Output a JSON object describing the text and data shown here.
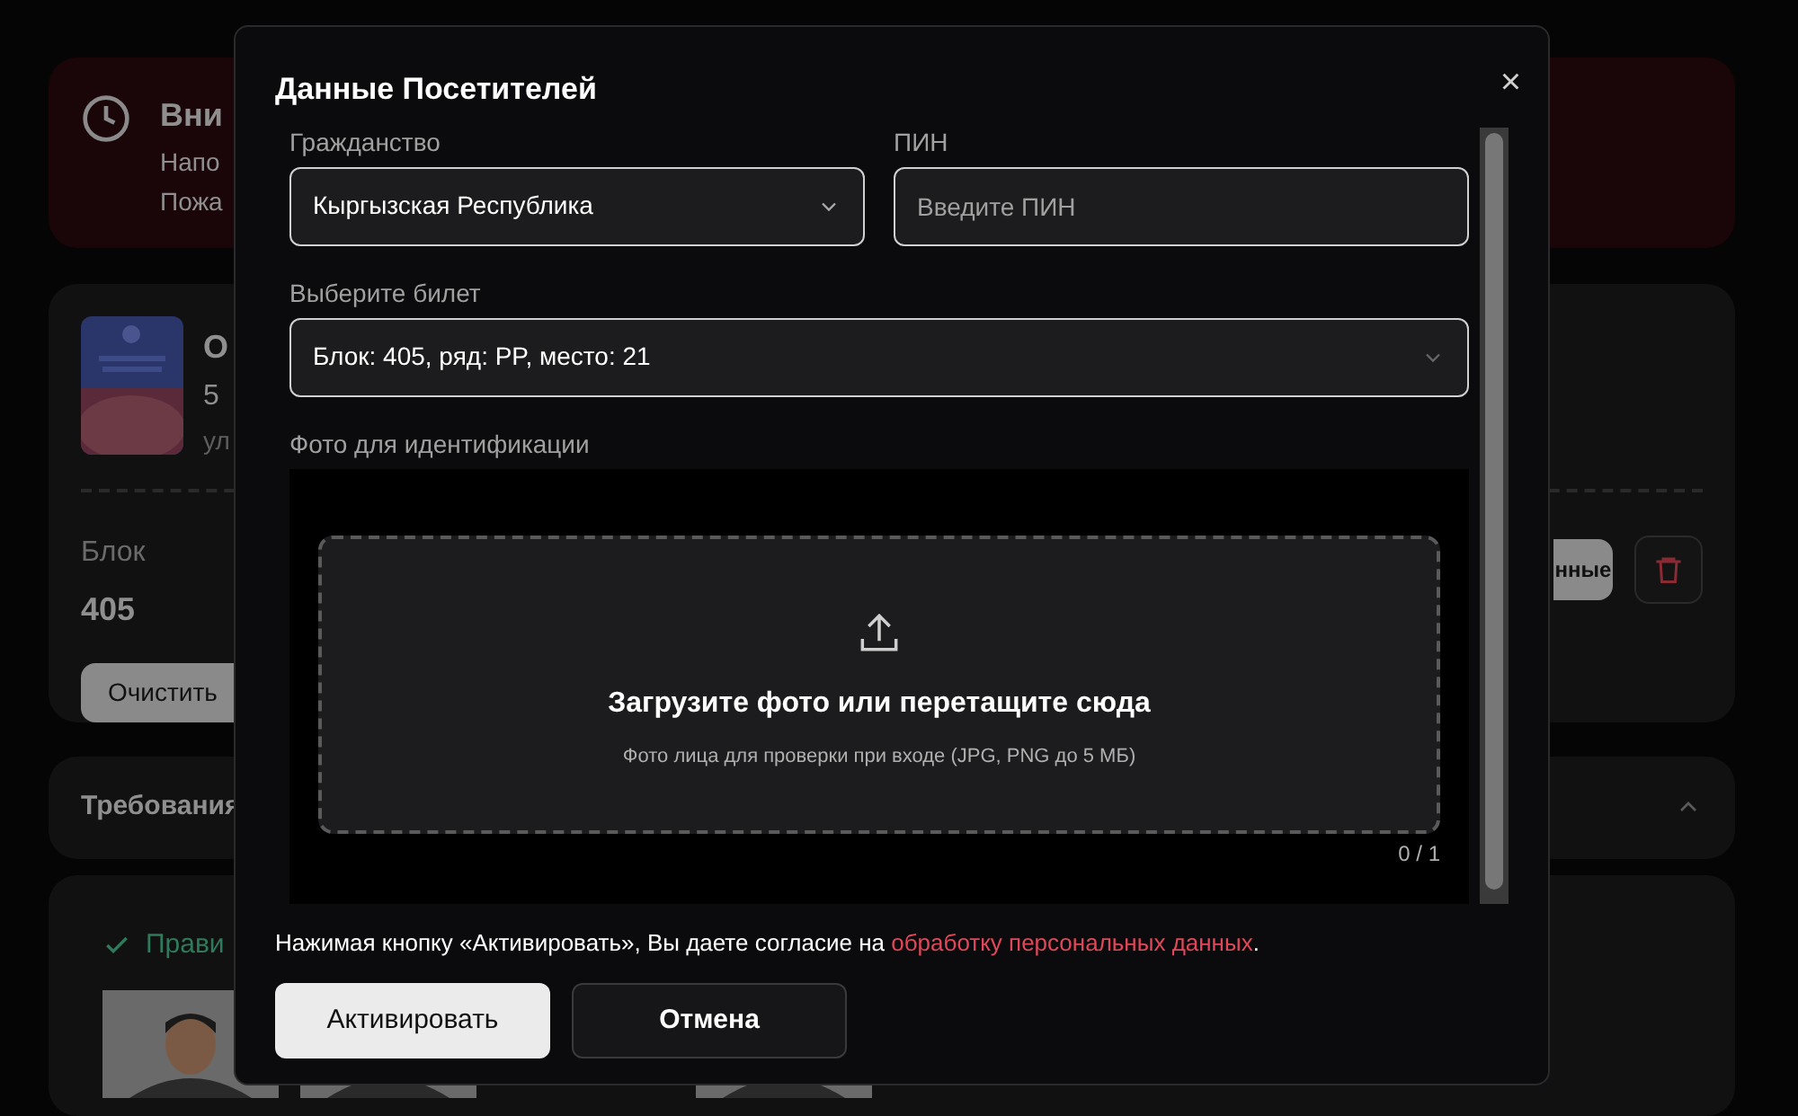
{
  "background": {
    "alert": {
      "title": "Вни",
      "lines": [
        "Напо",
        "Пожа"
      ]
    },
    "event": {
      "title": "О",
      "date": "5",
      "address": "ул",
      "block_label": "Блок",
      "block_value": "405",
      "clear_button": "Очистить",
      "data_button": "нные"
    },
    "requirements": {
      "title": "Требования",
      "expanded": true
    },
    "rules": {
      "title": "Прави"
    }
  },
  "modal": {
    "title": "Данные Посетителей",
    "close": "×",
    "citizenship": {
      "label": "Гражданство",
      "value": "Кыргызская Республика"
    },
    "pin": {
      "label": "ПИН",
      "placeholder": "Введите ПИН"
    },
    "ticket": {
      "label": "Выберите билет",
      "value": "Блок: 405, ряд: PP, место: 21"
    },
    "photo": {
      "label": "Фото для идентификации",
      "upload_title": "Загрузите фото или перетащите сюда",
      "upload_hint": "Фото лица для проверки при входе (JPG, PNG до 5 МБ)",
      "counter": "0 / 1"
    },
    "consent": {
      "text": "Нажимая кнопку «Активировать», Вы даете согласие на",
      "link": "обработку персональных данных",
      "end": "."
    },
    "buttons": [
      {
        "label": "Активировать",
        "kind": "primary"
      },
      {
        "label": "Отмена",
        "kind": "secondary"
      }
    ]
  }
}
